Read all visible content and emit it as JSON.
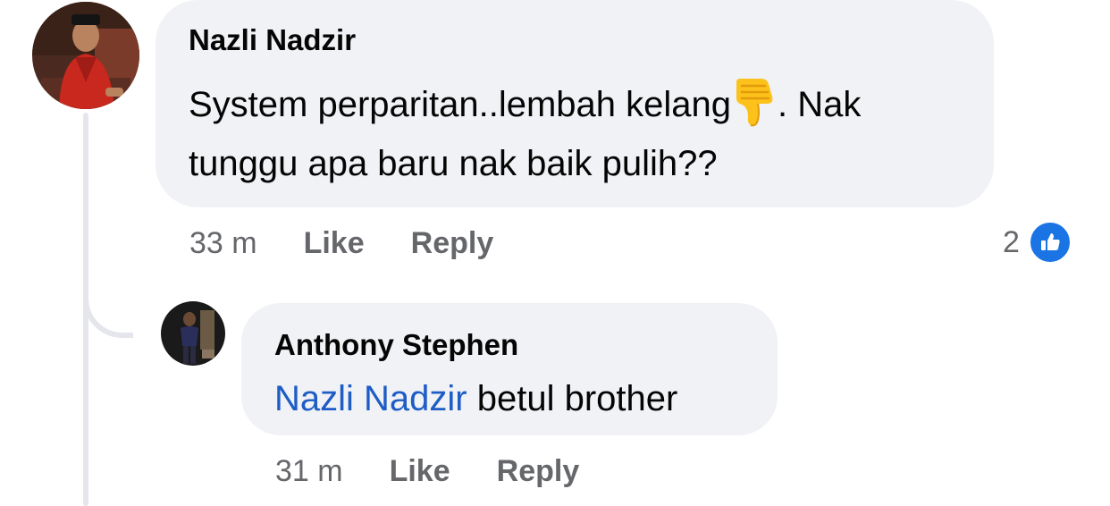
{
  "comments": [
    {
      "author": "Nazli Nadzir",
      "text_part1": "System perparitan..lembah kelang",
      "emoji": "thumbs-down-emoji",
      "text_part2": ". Nak tunggu apa baru nak baik pulih??",
      "time": "33 m",
      "like_label": "Like",
      "reply_label": "Reply",
      "reaction_count": "2",
      "reaction_icon": "like-icon"
    },
    {
      "author": "Anthony Stephen",
      "mention": "Nazli Nadzir",
      "text": " betul brother",
      "time": "31 m",
      "like_label": "Like",
      "reply_label": "Reply"
    }
  ],
  "colors": {
    "bubble": "#f0f2f5",
    "mention": "#1e5cc6",
    "meta": "#65676b",
    "like_badge": "#1b74e4",
    "thread_line": "#e4e6eb"
  }
}
